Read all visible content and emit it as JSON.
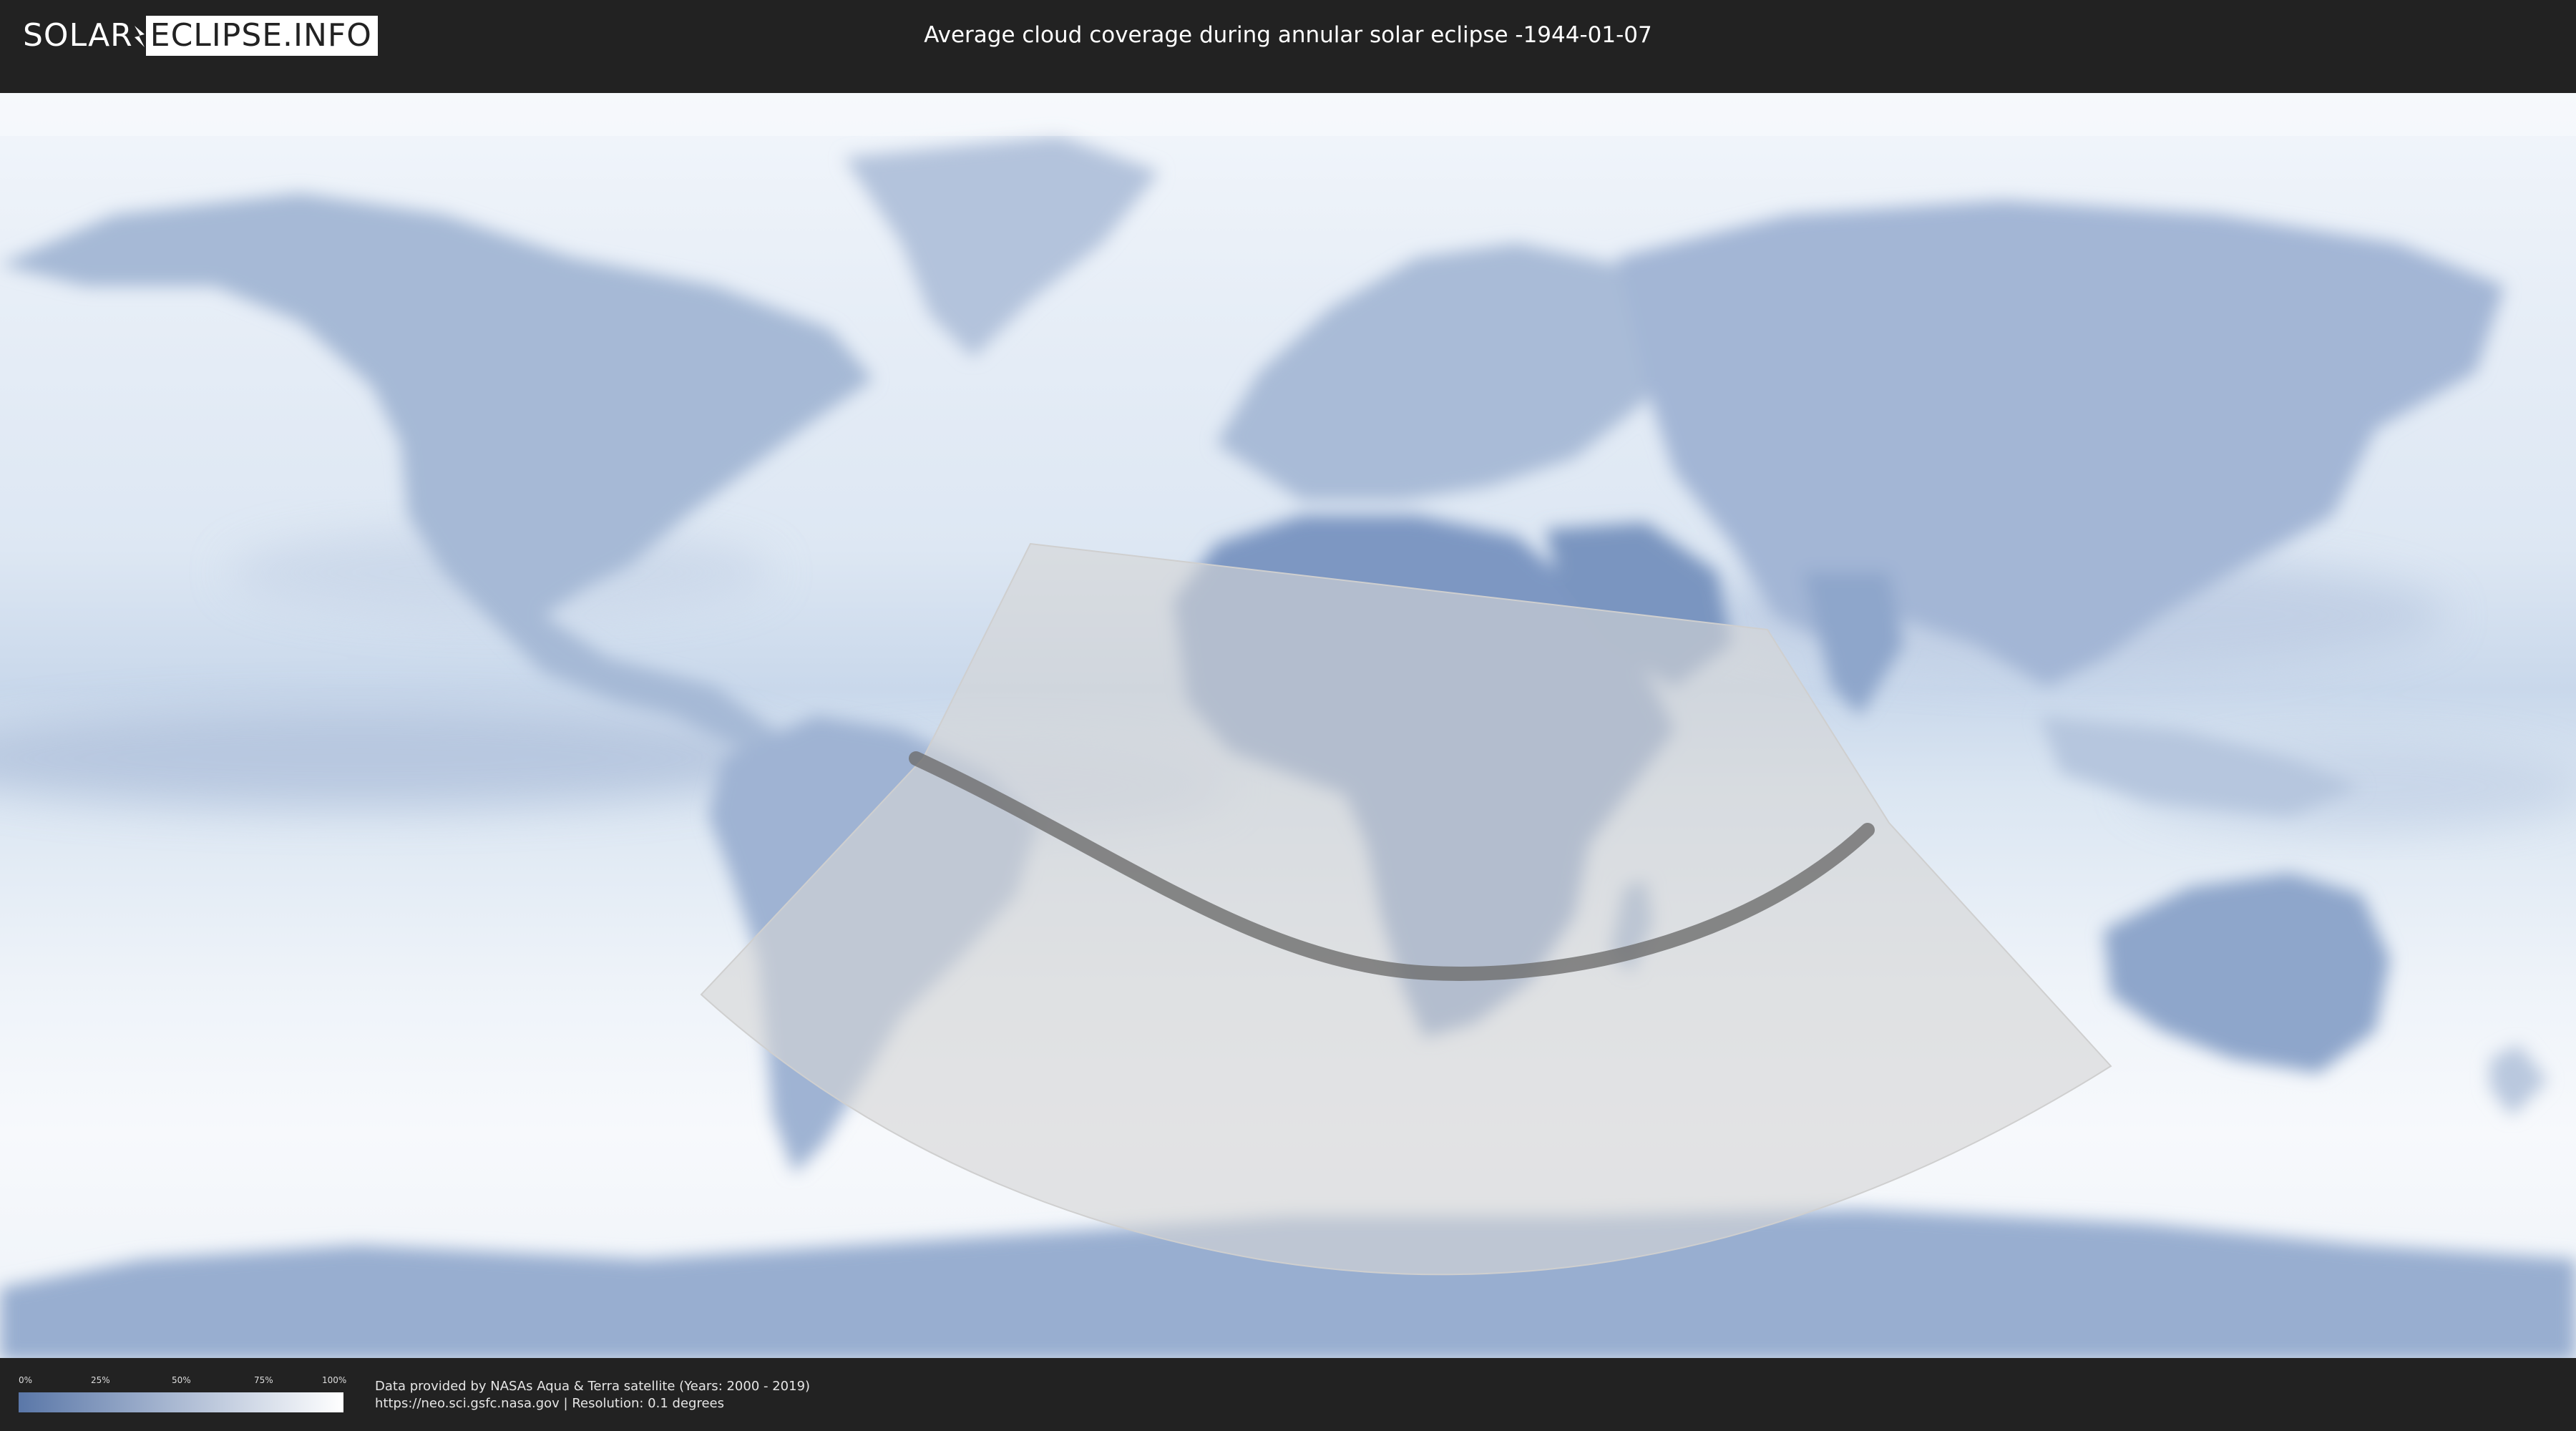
{
  "header": {
    "logo_left": "SOLAR",
    "logo_right": "ECLIPSE.INFO",
    "title": "Average cloud coverage during annular solar eclipse -1944-01-07"
  },
  "map": {
    "projection": "equirectangular",
    "colors": {
      "ocean_cloud": "#e9eff7",
      "land": "#8ea6c9",
      "clear_sky": "#6f8bb6",
      "eclipse_zone": "#d8d8d8",
      "central_path": "#6e6e6e",
      "frame": "#222222"
    }
  },
  "legend": {
    "ticks": [
      "0%",
      "25%",
      "50%",
      "75%",
      "100%"
    ],
    "gradient_start": "#5a77a8",
    "gradient_end": "#ffffff"
  },
  "footer": {
    "credit_line1": "Data provided by NASAs Aqua & Terra satellite (Years: 2000 - 2019)",
    "credit_line2": "https://neo.sci.gsfc.nasa.gov | Resolution: 0.1 degrees"
  }
}
